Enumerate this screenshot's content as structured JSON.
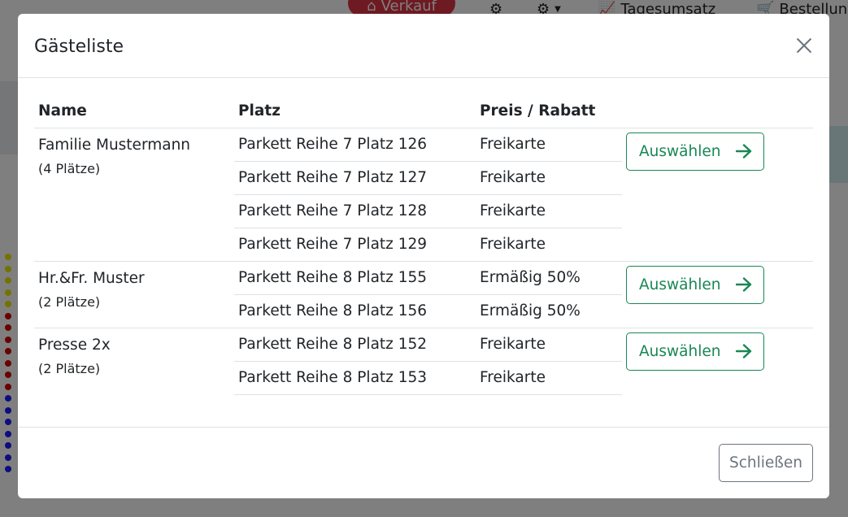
{
  "background": {
    "nav": {
      "verkauf_label": "Verkauf",
      "tagesumsatz_label": "Tagesumsatz",
      "bestellung_label": "Bestellung"
    }
  },
  "modal": {
    "title": "Gästeliste",
    "columns": {
      "name": "Name",
      "seat": "Platz",
      "price": "Preis / Rabatt"
    },
    "select_label": "Auswählen",
    "close_label": "Schließen",
    "groups": [
      {
        "name": "Familie Mustermann",
        "count": "(4 Plätze)",
        "seats": [
          {
            "seat": "Parkett Reihe 7 Platz 126",
            "price": "Freikarte"
          },
          {
            "seat": "Parkett Reihe 7 Platz 127",
            "price": "Freikarte"
          },
          {
            "seat": "Parkett Reihe 7 Platz 128",
            "price": "Freikarte"
          },
          {
            "seat": "Parkett Reihe 7 Platz 129",
            "price": "Freikarte"
          }
        ]
      },
      {
        "name": "Hr.&Fr. Muster",
        "count": "(2 Plätze)",
        "seats": [
          {
            "seat": "Parkett Reihe 8 Platz 155",
            "price": "Ermäßig 50%"
          },
          {
            "seat": "Parkett Reihe 8 Platz 156",
            "price": "Ermäßig 50%"
          }
        ]
      },
      {
        "name": "Presse 2x",
        "count": "(2 Plätze)",
        "seats": [
          {
            "seat": "Parkett Reihe 8 Platz 152",
            "price": "Freikarte"
          },
          {
            "seat": "Parkett Reihe 8 Platz 153",
            "price": "Freikarte"
          }
        ]
      }
    ]
  },
  "icons": {
    "close": "close-icon",
    "arrow": "arrow-right-icon",
    "home": "home-icon",
    "gear": "gear-icon",
    "chart": "line-chart-icon",
    "cart": "cart-icon"
  },
  "colors": {
    "success": "#198754",
    "danger": "#dc3545",
    "secondary": "#6c757d"
  }
}
